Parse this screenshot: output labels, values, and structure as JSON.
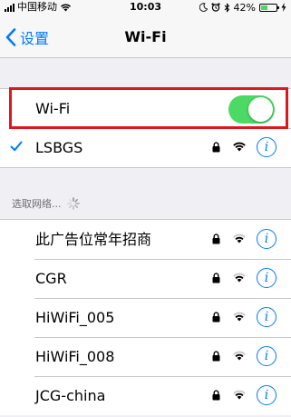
{
  "status_bar": {
    "carrier": "中国移动",
    "time": "10:03",
    "battery_text": "42%",
    "battery_level": 0.42,
    "icons": [
      "signal-icon",
      "wifi-icon",
      "moon-icon",
      "alarm-icon",
      "bluetooth-icon",
      "battery-icon",
      "charging-icon"
    ]
  },
  "nav": {
    "back_label": "设置",
    "title": "Wi-Fi"
  },
  "wifi_toggle": {
    "label": "Wi-Fi",
    "on": true
  },
  "connected_network": {
    "name": "LSBGS",
    "secured": true
  },
  "section_header": {
    "label": "选取网络..."
  },
  "networks": [
    {
      "name": "此广告位常年招商",
      "secured": true
    },
    {
      "name": "CGR",
      "secured": true
    },
    {
      "name": "HiWiFi_005",
      "secured": true
    },
    {
      "name": "HiWiFi_008",
      "secured": true
    },
    {
      "name": "JCG-china",
      "secured": true
    }
  ],
  "colors": {
    "accent": "#007aff",
    "toggle_on": "#4cd964",
    "highlight": "#e0161d",
    "background": "#efeff4"
  }
}
